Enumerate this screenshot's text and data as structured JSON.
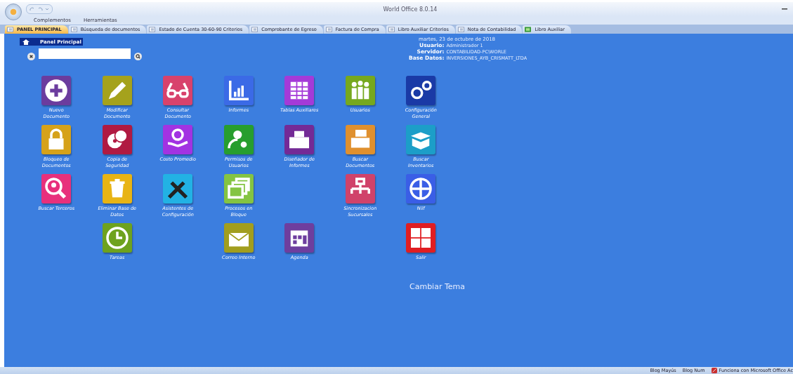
{
  "window": {
    "title": "World Office 8.0.14"
  },
  "menu": [
    "Complementos",
    "Herramientas"
  ],
  "tabs": [
    {
      "label": "PANEL PRINCIPAL",
      "selected": true,
      "kind": "form"
    },
    {
      "label": "Búsqueda de documentos",
      "selected": false,
      "kind": "form"
    },
    {
      "label": "Estado de Cuenta  30-60-90 Criterios",
      "selected": false,
      "kind": "form"
    },
    {
      "label": "Comprobante de Egreso",
      "selected": false,
      "kind": "form"
    },
    {
      "label": "Factura de Compra",
      "selected": false,
      "kind": "form"
    },
    {
      "label": "Libro Auxiliar Criterios",
      "selected": false,
      "kind": "form"
    },
    {
      "label": "Nota de Contabilidad",
      "selected": false,
      "kind": "form"
    },
    {
      "label": "Libro Auxiliar",
      "selected": false,
      "kind": "sheet"
    }
  ],
  "panel": {
    "title": "Panel Principal"
  },
  "info": {
    "date": "martes, 23 de octubre de 2018",
    "fields": [
      {
        "label": "Usuario:",
        "value": "Administrador 1"
      },
      {
        "label": "Servidor:",
        "value": "CONTABILIDAD-PC\\WORLE"
      },
      {
        "label": "Base Datos:",
        "value": "INVERSIONES_AYB_CRISMATT_LTDA"
      }
    ]
  },
  "tiles": [
    [
      {
        "label": "Nuevo\nDocumento",
        "color": "#6b3c9e"
      },
      {
        "label": "Modificar\nDocumento",
        "color": "#a5a21c"
      },
      {
        "label": "Consultar\nDocumento",
        "color": "#d8426c"
      },
      {
        "label": "Informes",
        "color": "#3b6ae6"
      },
      {
        "label": "Tablas Auxiliares",
        "color": "#a43ad8"
      },
      {
        "label": "Usuarios",
        "color": "#76a81e"
      },
      {
        "label": "Configuración\nGeneral",
        "color": "#1a3aa6"
      }
    ],
    [
      {
        "label": "Bloqueo de\nDocumentos",
        "color": "#d6a21a"
      },
      {
        "label": "Copia de\nSeguridad",
        "color": "#b01a42"
      },
      {
        "label": "Costo Promedio",
        "color": "#a233e2"
      },
      {
        "label": "Permisos de\nUsuarios",
        "color": "#279e2e"
      },
      {
        "label": "Diseñador de\nInformes",
        "color": "#742a96"
      },
      {
        "label": "Buscar\nDocumentos",
        "color": "#e0902e"
      },
      {
        "label": "Buscar\nInventarios",
        "color": "#1c9ec8"
      }
    ],
    [
      {
        "label": "Buscar Terceros",
        "color": "#e8307c"
      },
      {
        "label": "Eliminar Base de\nDatos",
        "color": "#e8b414"
      },
      {
        "label": "Asistentes de\nConfiguración",
        "color": "#22b2e4"
      },
      {
        "label": "Procesos en\nBloque",
        "color": "#84c442"
      },
      {
        "label": "Sincronizacion\nSucursales",
        "color": "#d0426a"
      },
      {
        "label": "Niif",
        "color": "#3a5ee6"
      }
    ],
    [
      {
        "label": "Tareas",
        "color": "#6ea21e"
      },
      {
        "label": "Correo Interno",
        "color": "#a29e1e"
      },
      {
        "label": "Agenda",
        "color": "#6e3e9e"
      },
      {
        "label": "Salir",
        "color": "#e01e22"
      }
    ]
  ],
  "theme_link": "Cambiar Tema",
  "status_bar": [
    "Blog Mayús",
    "Blog Num",
    "Funciona con Microsoft Office Ac"
  ]
}
